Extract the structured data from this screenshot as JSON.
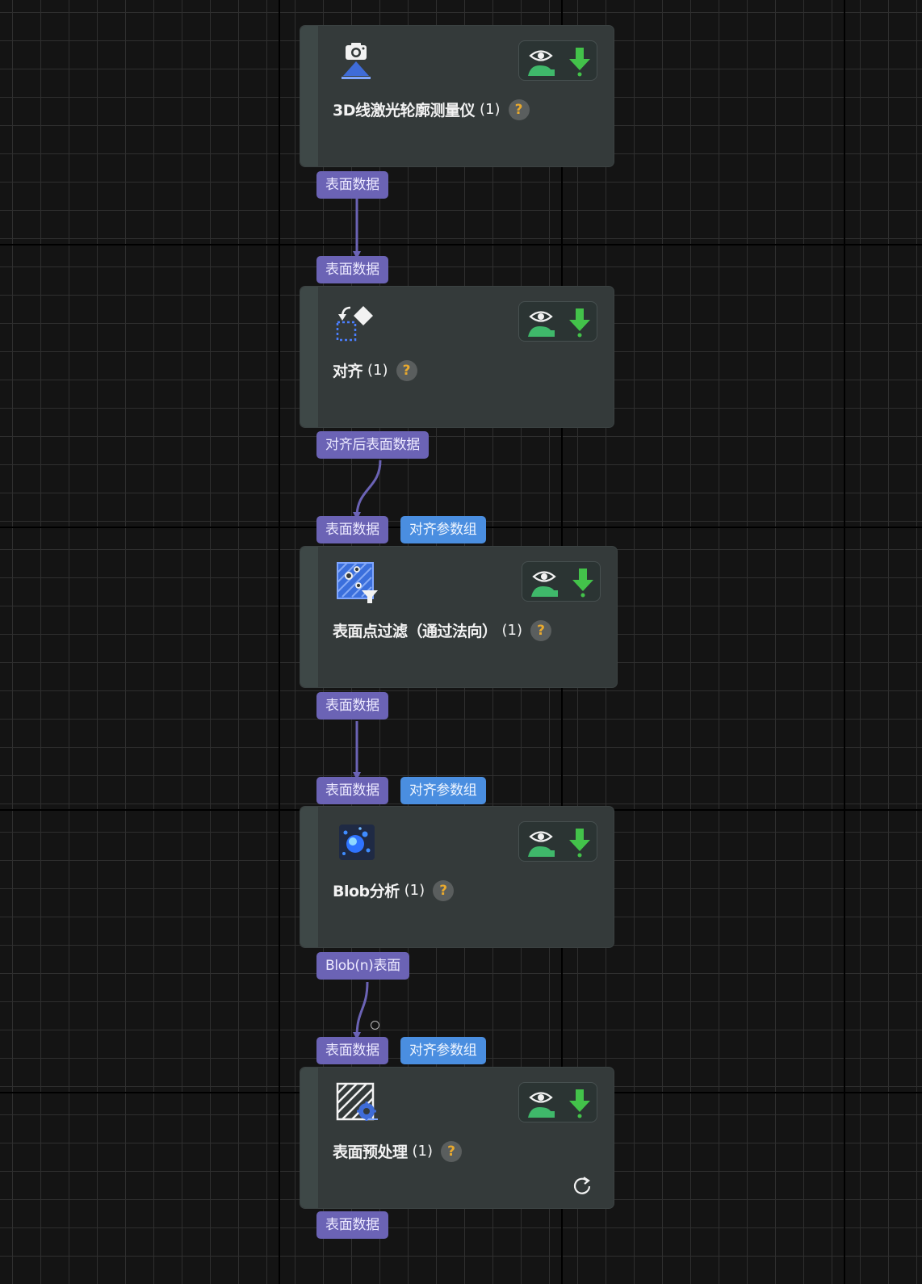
{
  "colors": {
    "background": "#141414",
    "node_body": "#343a3a",
    "port_output": "#6b63b5",
    "port_param": "#4a8ee0",
    "wire": "#6b63b5",
    "eye_icon": "#3fb86a",
    "download_icon": "#43c24a",
    "help_badge_text": "#e8a92e"
  },
  "nodes": [
    {
      "title": "3D线激光轮廓测量仪",
      "count": "(1)",
      "help": "?",
      "icon": "camera-icon",
      "inputs": [],
      "outputs": [
        "表面数据"
      ]
    },
    {
      "title": "对齐",
      "count": "(1)",
      "help": "?",
      "icon": "align-icon",
      "inputs": [
        "表面数据"
      ],
      "outputs": [
        "对齐后表面数据"
      ]
    },
    {
      "title": "表面点过滤（通过法向）",
      "count": "(1)",
      "help": "?",
      "icon": "surface-filter-icon",
      "inputs": [
        "表面数据",
        "对齐参数组"
      ],
      "outputs": [
        "表面数据"
      ]
    },
    {
      "title": "Blob分析",
      "count": "(1)",
      "help": "?",
      "icon": "blob-icon",
      "inputs": [
        "表面数据",
        "对齐参数组"
      ],
      "outputs": [
        "Blob(n)表面"
      ]
    },
    {
      "title": "表面预处理",
      "count": "(1)",
      "help": "?",
      "icon": "surface-preprocess-icon",
      "inputs": [
        "表面数据",
        "对齐参数组"
      ],
      "outputs": [
        "表面数据"
      ]
    }
  ],
  "actions": {
    "view_icon": "eye-icon",
    "export_icon": "download-icon",
    "refresh_icon": "refresh-icon"
  }
}
